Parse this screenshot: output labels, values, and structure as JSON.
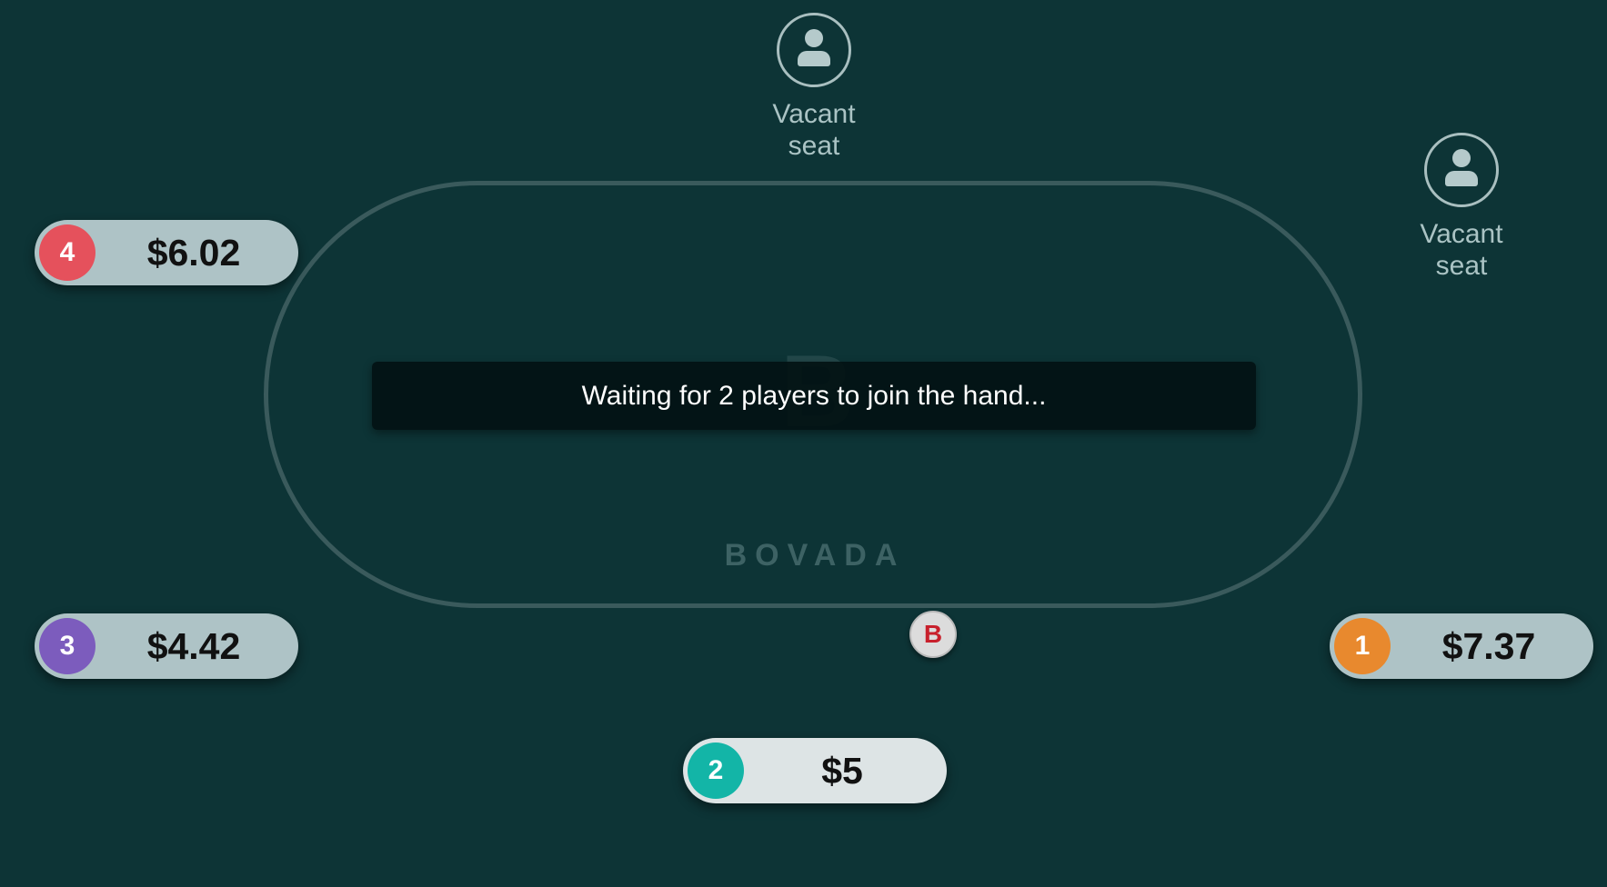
{
  "status": {
    "message": "Waiting for 2 players to join the hand..."
  },
  "brand": {
    "name": "BOVADA",
    "logo_mark": "B"
  },
  "vacant_seats": [
    {
      "line1": "Vacant",
      "line2": "seat",
      "icon": "person-icon"
    },
    {
      "line1": "Vacant",
      "line2": "seat",
      "icon": "person-icon"
    }
  ],
  "players": [
    {
      "seat": "1",
      "stack": "$7.37",
      "color": "#e8892e"
    },
    {
      "seat": "2",
      "stack": "$5",
      "color": "#13b5a7"
    },
    {
      "seat": "3",
      "stack": "$4.42",
      "color": "#7c5cbd"
    },
    {
      "seat": "4",
      "stack": "$6.02",
      "color": "#e5515c"
    }
  ],
  "dealer_button": {
    "label": "B",
    "color": "#c8202c"
  },
  "colors": {
    "felt": "#0d3436",
    "rail": "#3a5a5c",
    "active_pill": "#dde4e5",
    "inactive_pill": "#aec3c6"
  }
}
